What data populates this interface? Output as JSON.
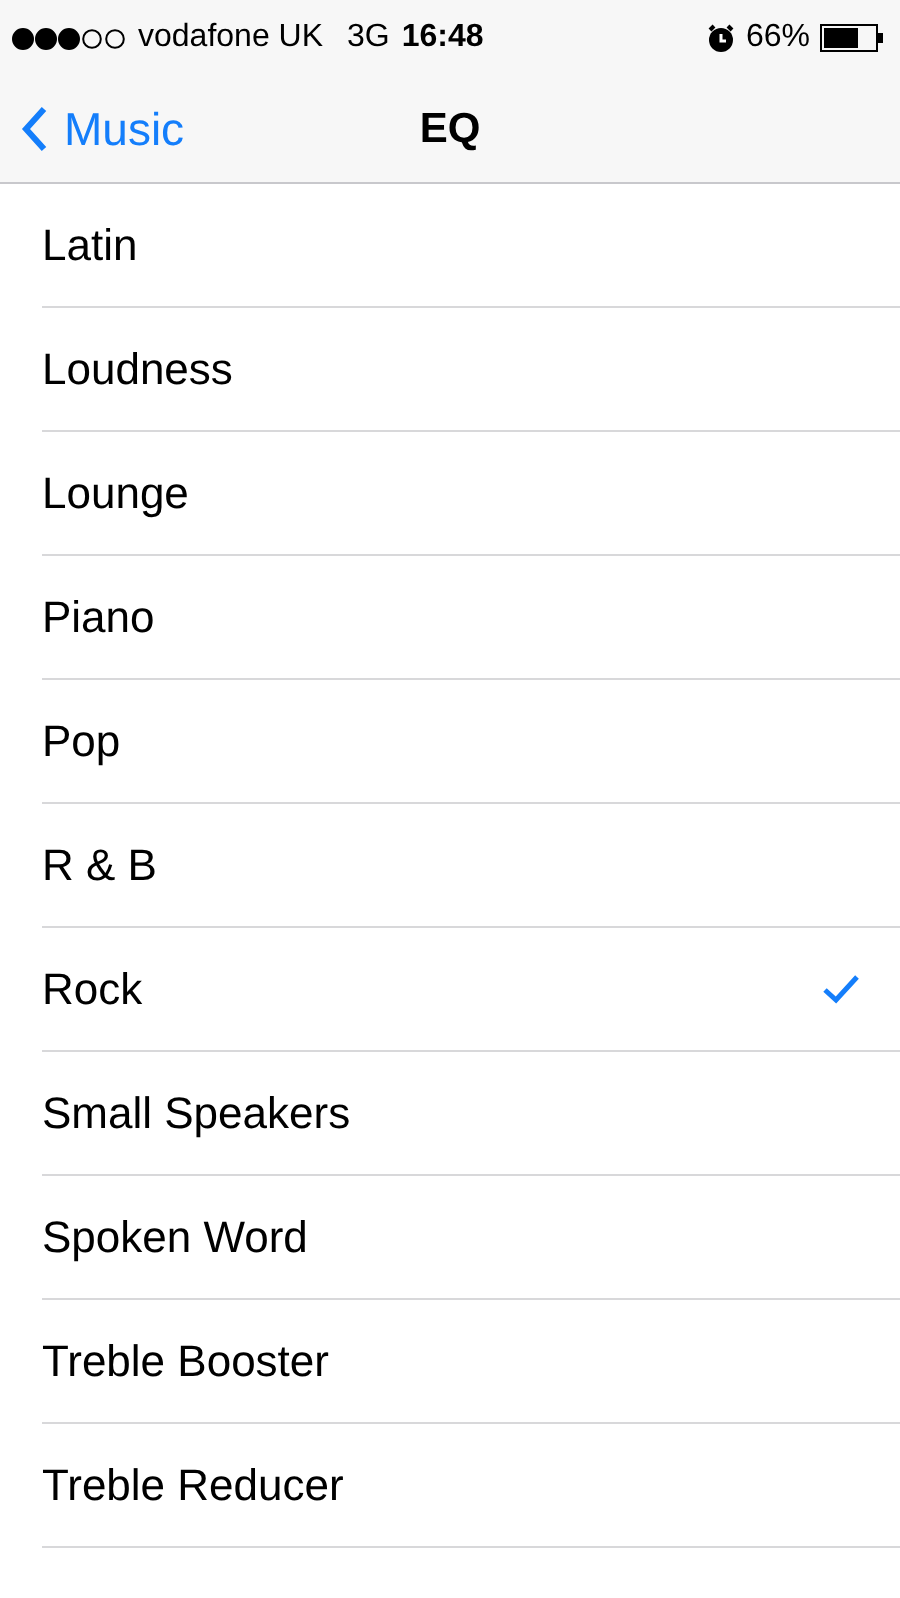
{
  "status_bar": {
    "carrier": "vodafone UK",
    "network": "3G",
    "time": "16:48",
    "battery": "66%"
  },
  "nav_bar": {
    "back": "Music",
    "title": "EQ"
  },
  "presets": [
    {
      "label": "Latin",
      "selected": false
    },
    {
      "label": "Loudness",
      "selected": false
    },
    {
      "label": "Lounge",
      "selected": false
    },
    {
      "label": "Piano",
      "selected": false
    },
    {
      "label": "Pop",
      "selected": false
    },
    {
      "label": "R & B",
      "selected": false
    },
    {
      "label": "Rock",
      "selected": true
    },
    {
      "label": "Small Speakers",
      "selected": false
    },
    {
      "label": "Spoken Word",
      "selected": false
    },
    {
      "label": "Treble Booster",
      "selected": false
    },
    {
      "label": "Treble Reducer",
      "selected": false
    }
  ]
}
